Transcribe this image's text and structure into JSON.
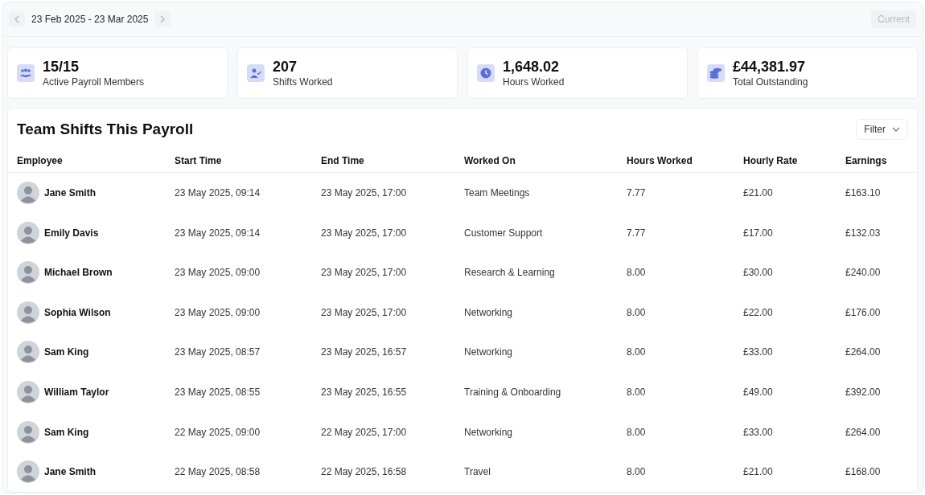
{
  "date_range": {
    "label": "23 Feb 2025 - 23 Mar 2025"
  },
  "current_button": {
    "label": "Current",
    "disabled": true
  },
  "stats": [
    {
      "kind": "members",
      "value": "15/15",
      "label": "Active Payroll Members"
    },
    {
      "kind": "shifts",
      "value": "207",
      "label": "Shifts Worked"
    },
    {
      "kind": "hours",
      "value": "1,648.02",
      "label": "Hours Worked"
    },
    {
      "kind": "money",
      "value": "£44,381.97",
      "label": "Total Outstanding"
    }
  ],
  "table": {
    "title": "Team Shifts This Payroll",
    "filter_label": "Filter",
    "columns": [
      "Employee",
      "Start Time",
      "End Time",
      "Worked On",
      "Hours Worked",
      "Hourly Rate",
      "Earnings"
    ],
    "rows": [
      {
        "employee": "Jane Smith",
        "start": "23 May 2025, 09:14",
        "end": "23 May 2025, 17:00",
        "worked_on": "Team Meetings",
        "hours": "7.77",
        "rate": "£21.00",
        "earnings": "£163.10"
      },
      {
        "employee": "Emily Davis",
        "start": "23 May 2025, 09:14",
        "end": "23 May 2025, 17:00",
        "worked_on": "Customer Support",
        "hours": "7.77",
        "rate": "£17.00",
        "earnings": "£132.03"
      },
      {
        "employee": "Michael Brown",
        "start": "23 May 2025, 09:00",
        "end": "23 May 2025, 17:00",
        "worked_on": "Research & Learning",
        "hours": "8.00",
        "rate": "£30.00",
        "earnings": "£240.00"
      },
      {
        "employee": "Sophia Wilson",
        "start": "23 May 2025, 09:00",
        "end": "23 May 2025, 17:00",
        "worked_on": "Networking",
        "hours": "8.00",
        "rate": "£22.00",
        "earnings": "£176.00"
      },
      {
        "employee": "Sam King",
        "start": "23 May 2025, 08:57",
        "end": "23 May 2025, 16:57",
        "worked_on": "Networking",
        "hours": "8.00",
        "rate": "£33.00",
        "earnings": "£264.00"
      },
      {
        "employee": "William Taylor",
        "start": "23 May 2025, 08:55",
        "end": "23 May 2025, 16:55",
        "worked_on": "Training & Onboarding",
        "hours": "8.00",
        "rate": "£49.00",
        "earnings": "£392.00"
      },
      {
        "employee": "Sam King",
        "start": "22 May 2025, 09:00",
        "end": "22 May 2025, 17:00",
        "worked_on": "Networking",
        "hours": "8.00",
        "rate": "£33.00",
        "earnings": "£264.00"
      },
      {
        "employee": "Jane Smith",
        "start": "22 May 2025, 08:58",
        "end": "22 May 2025, 16:58",
        "worked_on": "Travel",
        "hours": "8.00",
        "rate": "£21.00",
        "earnings": "£168.00"
      }
    ]
  }
}
